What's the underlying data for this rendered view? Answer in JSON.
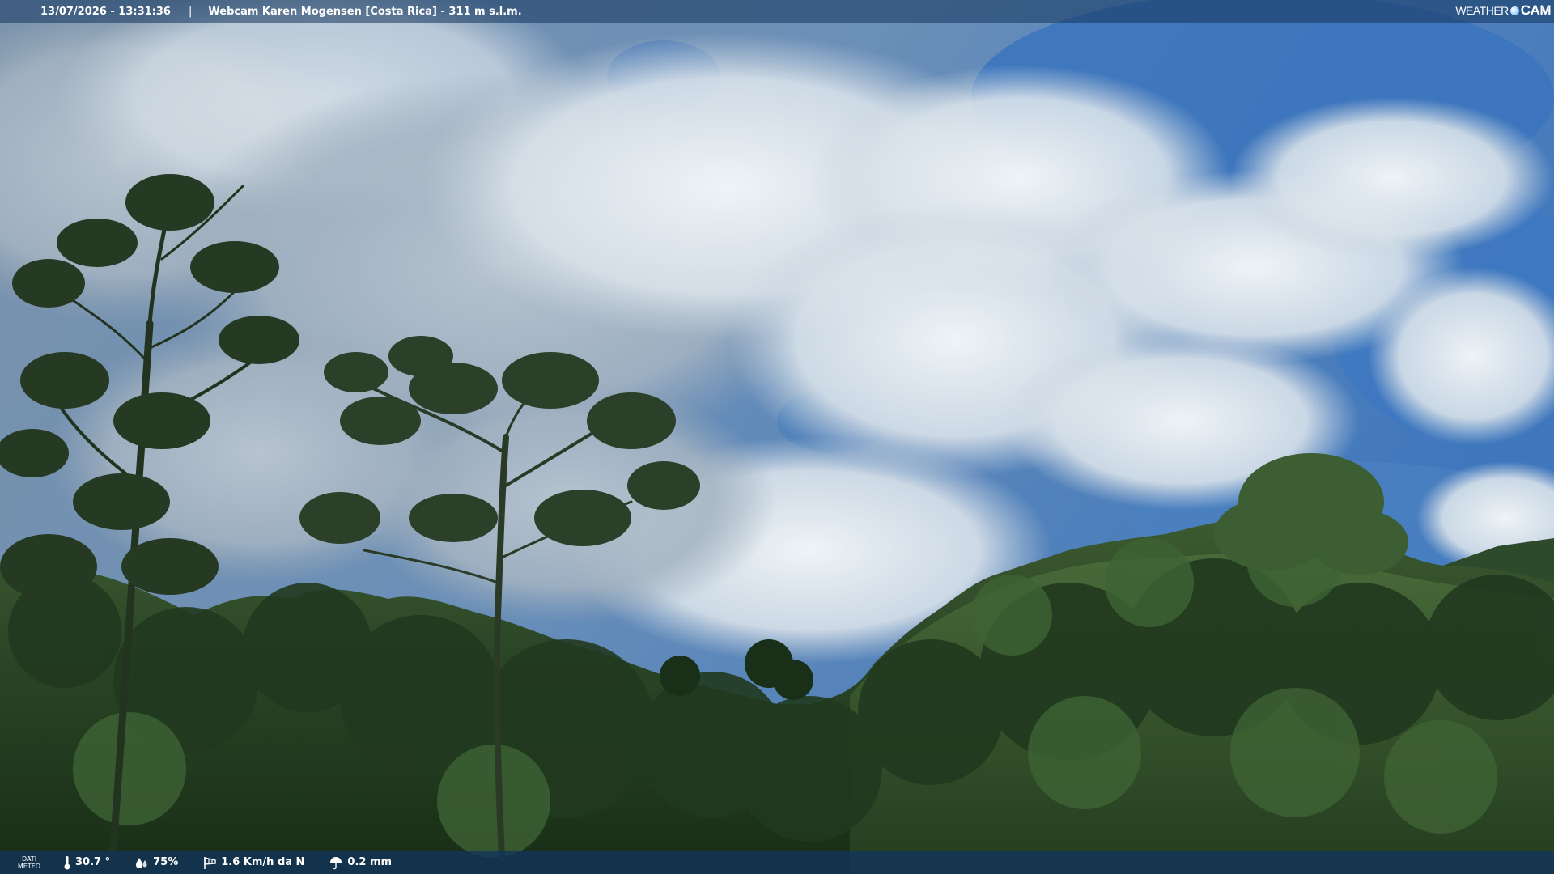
{
  "header": {
    "datetime": "13/07/2026 - 13:31:36",
    "separator": "|",
    "title": "Webcam Karen Mogensen [Costa Rica] - 311 m s.l.m."
  },
  "brand": {
    "weather": "WEATHER",
    "cam": "CAM"
  },
  "footer": {
    "label_line1": "DATI",
    "label_line2": "METEO",
    "temperature": "30.7 °",
    "humidity": "75%",
    "wind": "1.6 Km/h da N",
    "rain": "0.2 mm"
  },
  "icons": {
    "temperature": "thermometer-icon",
    "humidity": "humidity-drops-icon",
    "wind": "windsock-icon",
    "rain": "rain-umbrella-icon"
  },
  "colors": {
    "bar": "#12345c",
    "sky": "#5a86bf",
    "cloud": "#e4ebf0",
    "forest": "#1d3a1c"
  }
}
